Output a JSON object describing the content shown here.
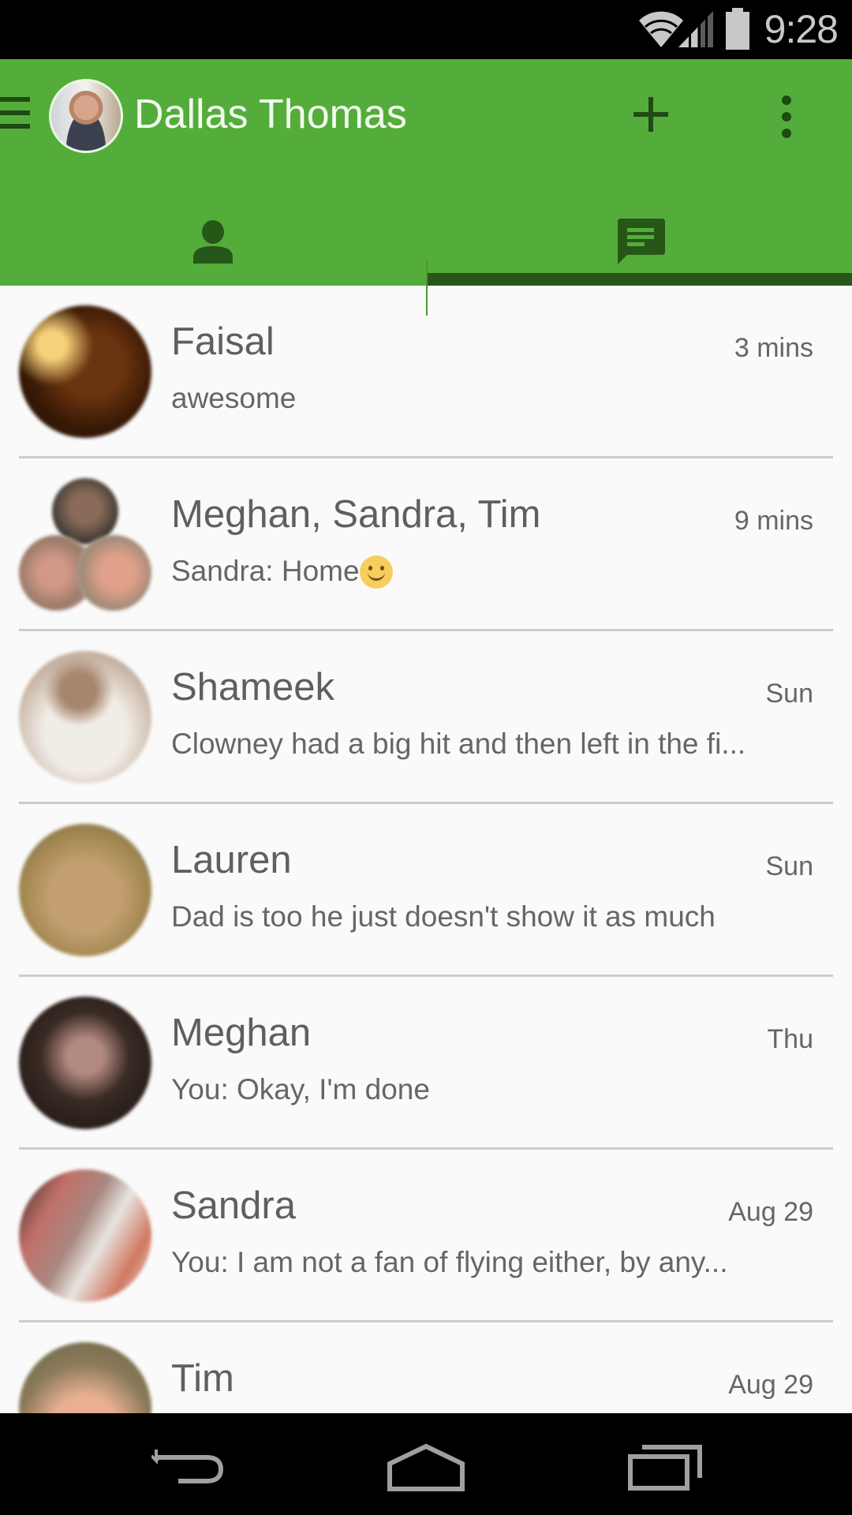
{
  "status_bar": {
    "time": "9:28",
    "icons": [
      "wifi-icon",
      "cellular-signal-icon",
      "battery-icon"
    ]
  },
  "appbar": {
    "title": "Dallas Thomas",
    "menu_icon": "hamburger-menu-icon",
    "add_icon": "plus-icon",
    "more_icon": "more-vert-icon",
    "accent_color": "#54ad3a",
    "icon_color": "#1f4a14"
  },
  "tabs": [
    {
      "name": "contacts",
      "icon": "person-icon",
      "selected": false
    },
    {
      "name": "conversations",
      "icon": "chat-icon",
      "selected": true
    }
  ],
  "conversations": [
    {
      "name": "Faisal",
      "time": "3 mins",
      "message": "awesome"
    },
    {
      "name": "Meghan, Sandra, Tim",
      "time": "9 mins",
      "message": "Sandra: Home",
      "emoji": "smiley-emoji"
    },
    {
      "name": "Shameek",
      "time": "Sun",
      "message": "Clowney had a big hit and then left in the fi..."
    },
    {
      "name": "Lauren",
      "time": "Sun",
      "message": "Dad is too he just doesn't show it as much"
    },
    {
      "name": "Meghan",
      "time": "Thu",
      "message": "You: Okay, I'm done"
    },
    {
      "name": "Sandra",
      "time": "Aug 29",
      "message": "You: I am not a fan of flying either, by any..."
    },
    {
      "name": "Tim",
      "time": "Aug 29",
      "message": ""
    }
  ],
  "navbar": {
    "buttons": [
      "back-icon",
      "home-icon",
      "recent-apps-icon"
    ]
  }
}
